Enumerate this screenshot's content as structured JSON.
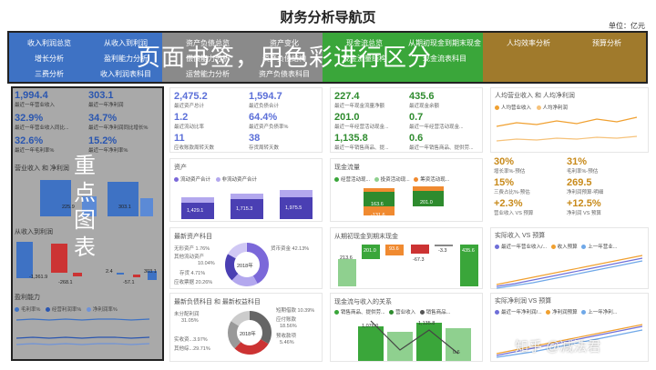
{
  "header": {
    "title": "财务分析导航页",
    "unit": "单位：亿元"
  },
  "nav": {
    "overlay": "页面书签，用色彩进行区分",
    "blue": [
      "收入利润总览",
      "从收入到利润",
      "增长分析",
      "盈利能力分析",
      "三费分析",
      "收入利润表科目"
    ],
    "gray": [
      "资产负债总览",
      "资产变化",
      "偿债能力分析",
      "资产负债结构",
      "运营能力分析",
      "资产负债表科目"
    ],
    "green": [
      "现金流总览",
      "从期初现金到期末现金",
      "现金流量结构",
      "现金流表科目"
    ],
    "brown": [
      "人均效率分析",
      "预算分析"
    ]
  },
  "colors": {
    "blue": "#3e72c4",
    "gray": "#8a8a8a",
    "green": "#3aa63a",
    "brown": "#a07a2c",
    "purple": "#7b68d9",
    "orange": "#f0a030"
  },
  "kpi1": [
    {
      "value": "1,994.4",
      "label": "最近一年营业收入"
    },
    {
      "value": "303.1",
      "label": "最近一年净利润"
    },
    {
      "value": "32.9%",
      "label": "最近一年营业收入同比..."
    },
    {
      "value": "34.7%",
      "label": "最近一年净利润同比增长%"
    },
    {
      "value": "32.6%",
      "label": "最近一年毛利率%"
    },
    {
      "value": "15.2%",
      "label": "最近一年净利率%"
    }
  ],
  "kpi2": [
    {
      "value": "2,475.2",
      "label": "最近资产总计"
    },
    {
      "value": "1,594.7",
      "label": "最近负债合计"
    },
    {
      "value": "1.2",
      "label": "最近流动比率"
    },
    {
      "value": "64.4%",
      "label": "最近资产负债率%"
    },
    {
      "value": "11",
      "label": "应收账款周转天数"
    },
    {
      "value": "38",
      "label": "存货周转天数"
    }
  ],
  "kpi3": [
    {
      "value": "227.4",
      "label": "最近一年现金流量净额"
    },
    {
      "value": "435.6",
      "label": "最近现金余额"
    },
    {
      "value": "201.0",
      "label": "最近一年经营活动现金..."
    },
    {
      "value": "0.7",
      "label": "最近一年经营活动现金..."
    },
    {
      "value": "1,135.8",
      "label": "最近一年销售商品、提..."
    },
    {
      "value": "0.6",
      "label": "最近一年销售商品、提供劳..."
    }
  ],
  "col1": {
    "overlay": "重点图表",
    "p1_title": "营业收入 和 净利润",
    "p1_labels": [
      "225.9",
      "303.1"
    ],
    "p2_title": "从收入到利润",
    "p2_labels": [
      "-1,361.9",
      "-268.1",
      "2.4",
      "-57.1",
      "303.1"
    ],
    "p3_title": "盈利能力",
    "p3_legend": [
      "毛利率%",
      "经营利润率%",
      "净利润率%"
    ]
  },
  "assets": {
    "title": "资产",
    "legend": [
      "流动资产合计",
      "非流动资产合计"
    ],
    "labels": [
      "1,429.1",
      "1,715.3",
      "1,975.5"
    ]
  },
  "cashflow": {
    "title": "现金流量",
    "legend": [
      "经营活动现...",
      "投资活动现...",
      "筹资活动现..."
    ],
    "labels": [
      "163.6",
      "-131.6",
      "201.0"
    ]
  },
  "per_capita": {
    "title": "人均营业收入 和 人均净利润",
    "legend": [
      "人均营业收入",
      "人均净利润"
    ],
    "kpis": [
      {
        "value": "30%",
        "label": "增长率%-预估"
      },
      {
        "value": "31%",
        "label": "毛利率%-预估"
      },
      {
        "value": "15%",
        "label": "三费占比%-预估"
      },
      {
        "value": "269.5",
        "label": "净利润预算-明细"
      },
      {
        "value": "+2.3%",
        "label": "营业收入 VS 预算"
      },
      {
        "value": "+12.5%",
        "label": "净利润 VS 预算"
      }
    ]
  },
  "asset_items": {
    "title": "最新资产科目",
    "center": "2018年",
    "left_labels": [
      "无形资产 1.76%",
      "其他流动资产",
      "10.04%",
      "存货 4.71%",
      "应收票据 20.26%"
    ],
    "right_labels": [
      "货币资金 42.13%"
    ]
  },
  "cash_bridge": {
    "title": "从期初现金到期末现金",
    "labels": [
      "213.6",
      "201.0",
      "93.6",
      "-67.3",
      "-3.3",
      "435.6"
    ]
  },
  "budget_rev": {
    "title": "实际收入 VS 预算",
    "legend": [
      "最近一年营业收入/...",
      "收入预算",
      "上一年营业..."
    ]
  },
  "liab_items": {
    "title": "最新负债科目 和 最新权益科目",
    "center": "2018年",
    "left_labels": [
      "未分配利润",
      "31.05%",
      "实收资...3.97%",
      "其他综...29.71%"
    ],
    "right_labels": [
      "短期借款 10.39%",
      "应付账款",
      "18.56%",
      "预收款项",
      "5.46%"
    ]
  },
  "cash_income": {
    "title": "现金流与收入的关系",
    "legend": [
      "销售商品、提供劳...",
      "营业收入",
      "销售商品..."
    ],
    "labels": [
      "1,076.0",
      "1,135.8",
      "0.6"
    ]
  },
  "budget_profit": {
    "title": "实际净利润 VS 预算",
    "legend": [
      "最近一年净利润/...",
      "净利润预算",
      "上一年净利..."
    ]
  },
  "watermark": "知乎 @减法君"
}
